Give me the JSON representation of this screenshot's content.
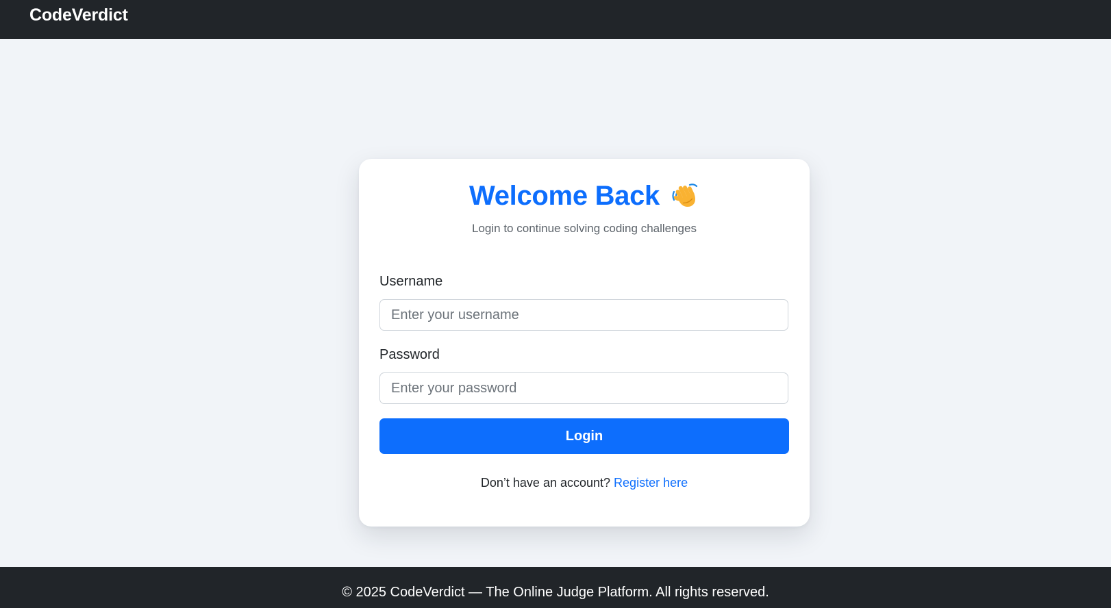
{
  "navbar": {
    "brand": "CodeVerdict"
  },
  "login": {
    "title": "Welcome Back",
    "title_icon": "waving-hand-icon",
    "subtitle": "Login to continue solving coding challenges",
    "username_label": "Username",
    "username_placeholder": "Enter your username",
    "username_value": "",
    "password_label": "Password",
    "password_placeholder": "Enter your password",
    "password_value": "",
    "submit_label": "Login",
    "register_prompt": "Don’t have an account?",
    "register_link": "Register here"
  },
  "footer": {
    "text": "© 2025 CodeVerdict — The Online Judge Platform. All rights reserved."
  },
  "colors": {
    "navbar_bg": "#212529",
    "page_bg": "#f1f4f8",
    "accent": "#0d6efd",
    "card_bg": "#ffffff"
  }
}
